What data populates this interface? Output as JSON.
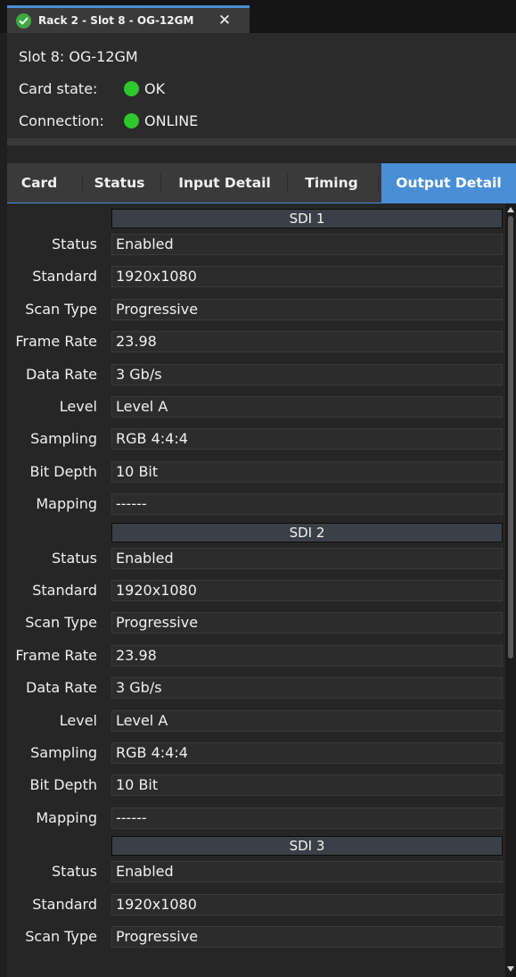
{
  "window_tab": {
    "title": "Rack 2 - Slot 8 - OG-12GM",
    "close_glyph": "✕",
    "status_icon": "check-icon"
  },
  "info": {
    "slot": "Slot 8: OG-12GM",
    "card_state_label": "Card state:",
    "card_state_value": "OK",
    "connection_label": "Connection:",
    "connection_value": "ONLINE",
    "status_color": "#2dc82d"
  },
  "tabs": [
    {
      "label": "Card"
    },
    {
      "label": "Status"
    },
    {
      "label": "Input Detail"
    },
    {
      "label": "Timing"
    },
    {
      "label": "Output Detail",
      "active": true
    }
  ],
  "accent_color": "#4a8fd6",
  "sections": [
    {
      "title": "SDI 1",
      "rows": [
        {
          "label": "Status",
          "value": "Enabled"
        },
        {
          "label": "Standard",
          "value": "1920x1080"
        },
        {
          "label": "Scan Type",
          "value": "Progressive"
        },
        {
          "label": "Frame Rate",
          "value": "23.98"
        },
        {
          "label": "Data Rate",
          "value": "3 Gb/s"
        },
        {
          "label": "Level",
          "value": "Level A"
        },
        {
          "label": "Sampling",
          "value": "RGB 4:4:4"
        },
        {
          "label": "Bit Depth",
          "value": "10 Bit"
        },
        {
          "label": "Mapping",
          "value": "------"
        }
      ]
    },
    {
      "title": "SDI 2",
      "rows": [
        {
          "label": "Status",
          "value": "Enabled"
        },
        {
          "label": "Standard",
          "value": "1920x1080"
        },
        {
          "label": "Scan Type",
          "value": "Progressive"
        },
        {
          "label": "Frame Rate",
          "value": "23.98"
        },
        {
          "label": "Data Rate",
          "value": "3 Gb/s"
        },
        {
          "label": "Level",
          "value": "Level A"
        },
        {
          "label": "Sampling",
          "value": "RGB 4:4:4"
        },
        {
          "label": "Bit Depth",
          "value": "10 Bit"
        },
        {
          "label": "Mapping",
          "value": "------"
        }
      ]
    },
    {
      "title": "SDI 3",
      "rows": [
        {
          "label": "Status",
          "value": "Enabled"
        },
        {
          "label": "Standard",
          "value": "1920x1080"
        },
        {
          "label": "Scan Type",
          "value": "Progressive"
        }
      ]
    }
  ]
}
